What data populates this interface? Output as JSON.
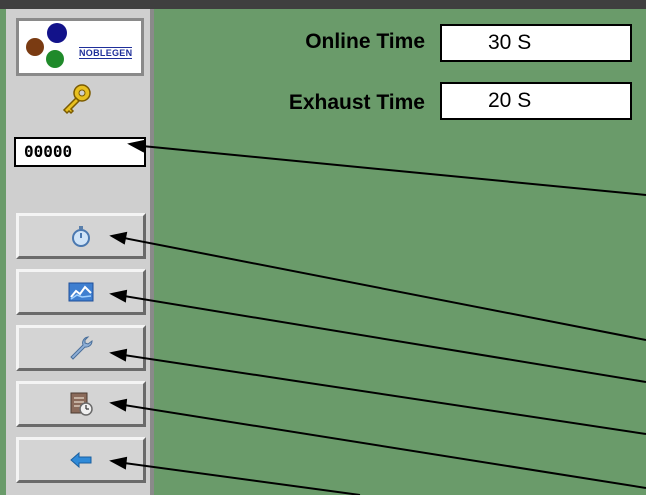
{
  "logo": {
    "text": "NOBLEGEN"
  },
  "password": {
    "value": "00000"
  },
  "settings": {
    "online_time_label": "Online Time",
    "online_time_value": "30 S",
    "exhaust_time_label": "Exhaust Time",
    "exhaust_time_value": "20 S"
  },
  "nav": [
    {
      "icon": "stopwatch-icon"
    },
    {
      "icon": "chart-icon"
    },
    {
      "icon": "wrench-icon"
    },
    {
      "icon": "calendar-clock-icon"
    },
    {
      "icon": "back-arrow-icon"
    }
  ],
  "colors": {
    "background": "#6a9b6a",
    "sidebar": "#cfcfcf",
    "key": "#e8c020",
    "arrow": "#2f8ad8"
  }
}
